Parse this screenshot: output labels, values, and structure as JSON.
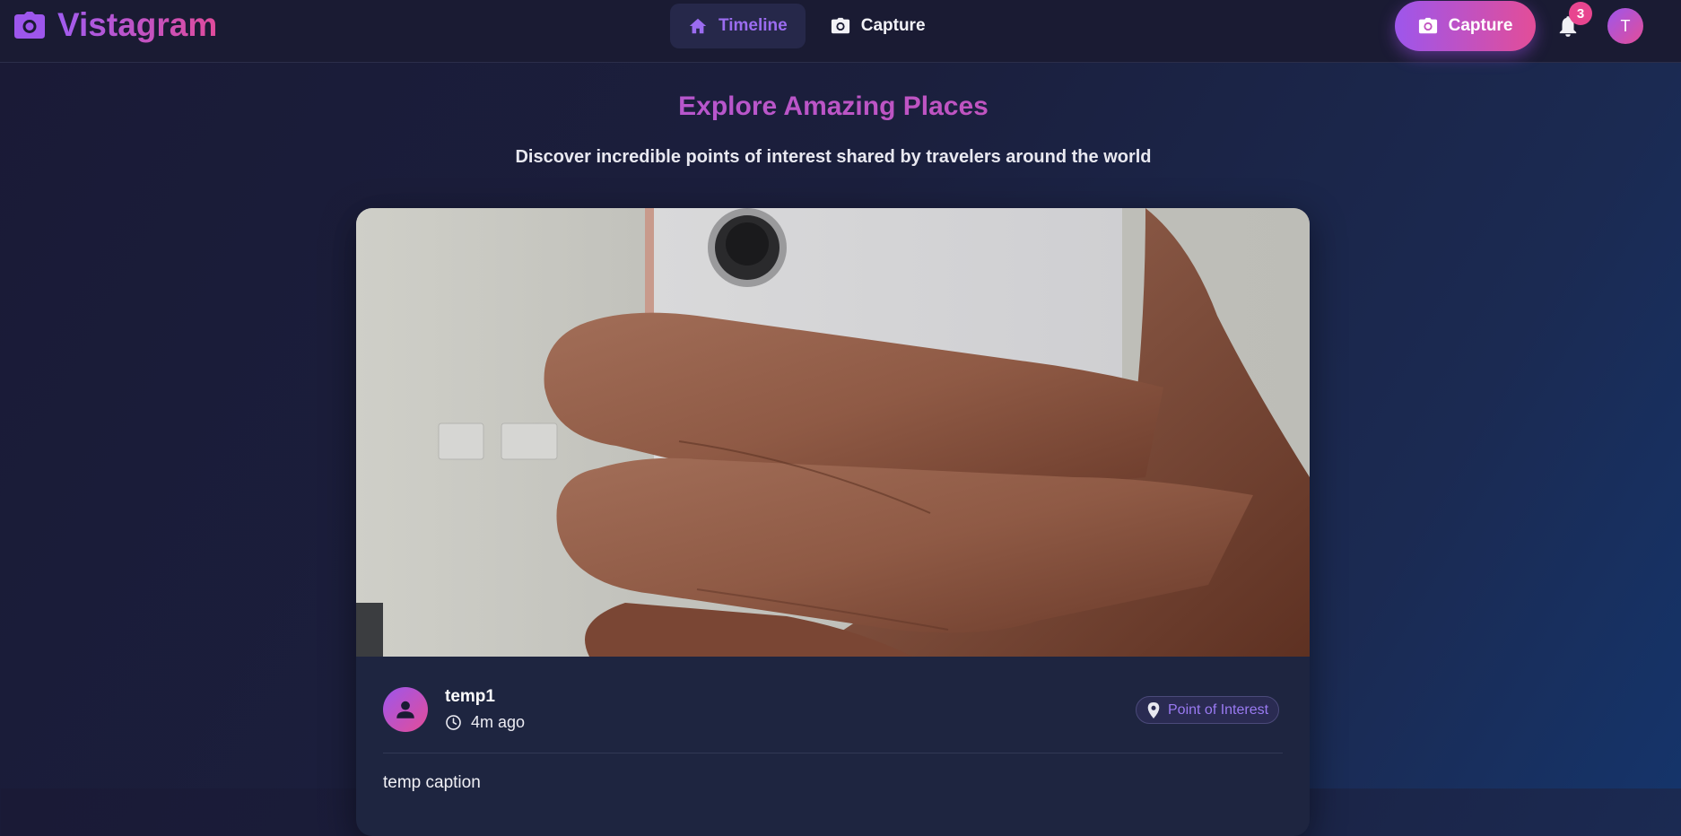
{
  "app": {
    "brand": "Vistagram"
  },
  "nav": {
    "items": [
      {
        "label": "Timeline",
        "icon": "home-icon",
        "active": true
      },
      {
        "label": "Capture",
        "icon": "camera-icon",
        "active": false
      }
    ]
  },
  "header": {
    "capture_label": "Capture",
    "notification_count": "3",
    "user_initial": "T"
  },
  "hero": {
    "title": "Explore Amazing Places",
    "subtitle": "Discover incredible points of interest shared by travelers around the world"
  },
  "post": {
    "author": "temp1",
    "time_ago": "4m ago",
    "tag": "Point of Interest",
    "caption": "temp caption"
  },
  "colors": {
    "accent_purple": "#9d56ec",
    "accent_pink": "#e34d98",
    "background": "#1a1a36",
    "card": "#1e2540"
  }
}
